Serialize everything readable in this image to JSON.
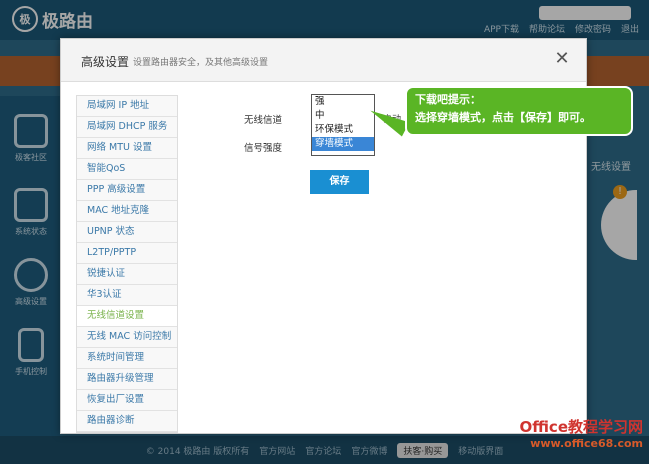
{
  "app": {
    "logo": "极路由",
    "topnav": [
      "APP下载",
      "帮助论坛",
      "修改密码",
      "退出"
    ]
  },
  "left_nav": [
    {
      "label": "极客社区",
      "icon": "home-icon"
    },
    {
      "label": "系统状态",
      "icon": "pulse-icon"
    },
    {
      "label": "高级设置",
      "icon": "gear-icon"
    },
    {
      "label": "手机控制",
      "icon": "phone-icon"
    }
  ],
  "right_label": "无线设置",
  "badge": "!",
  "footer": {
    "copyright": "© 2014 极路由 版权所有",
    "links": [
      "官方网站",
      "官方论坛",
      "官方微博"
    ],
    "pill": "扶客·购买",
    "mobile": "移动版界面"
  },
  "watermark": {
    "brand": "Office教程学习网",
    "url": "www.office68.com"
  },
  "modal": {
    "title": "高级设置",
    "subtitle": "设置路由器安全，及其他高级设置",
    "close_glyph": "✕",
    "menu": [
      {
        "label": "局域网 IP 地址",
        "active": false
      },
      {
        "label": "局域网 DHCP 服务",
        "active": false
      },
      {
        "label": "网络 MTU 设置",
        "active": false
      },
      {
        "label": "智能QoS",
        "active": false
      },
      {
        "label": "PPP 高级设置",
        "active": false
      },
      {
        "label": "MAC 地址克隆",
        "active": false
      },
      {
        "label": "UPNP 状态",
        "active": false
      },
      {
        "label": "L2TP/PPTP",
        "active": false
      },
      {
        "label": "锐捷认证",
        "active": false
      },
      {
        "label": "华3认证",
        "active": false
      },
      {
        "label": "无线信道设置",
        "active": true
      },
      {
        "label": "无线 MAC 访问控制",
        "active": false
      },
      {
        "label": "系统时间管理",
        "active": false
      },
      {
        "label": "路由器升级管理",
        "active": false
      },
      {
        "label": "恢复出厂设置",
        "active": false
      },
      {
        "label": "路由器诊断",
        "active": false
      }
    ],
    "form": {
      "channel_label": "无线信道",
      "signal_label": "信号强度",
      "auto_text": "自动",
      "signal_options": [
        "强",
        "中",
        "环保模式",
        "穿墙模式"
      ],
      "selected": "穿墙模式",
      "save_label": "保存"
    }
  },
  "tip": {
    "line1": "下载吧提示：",
    "line2": "选择穿墙模式，点击【保存】即可。"
  },
  "colors": {
    "accent": "#1a8fd2",
    "tip_green": "#5ab525",
    "active_menu": "#7ab34c",
    "link": "#3b79a8"
  }
}
